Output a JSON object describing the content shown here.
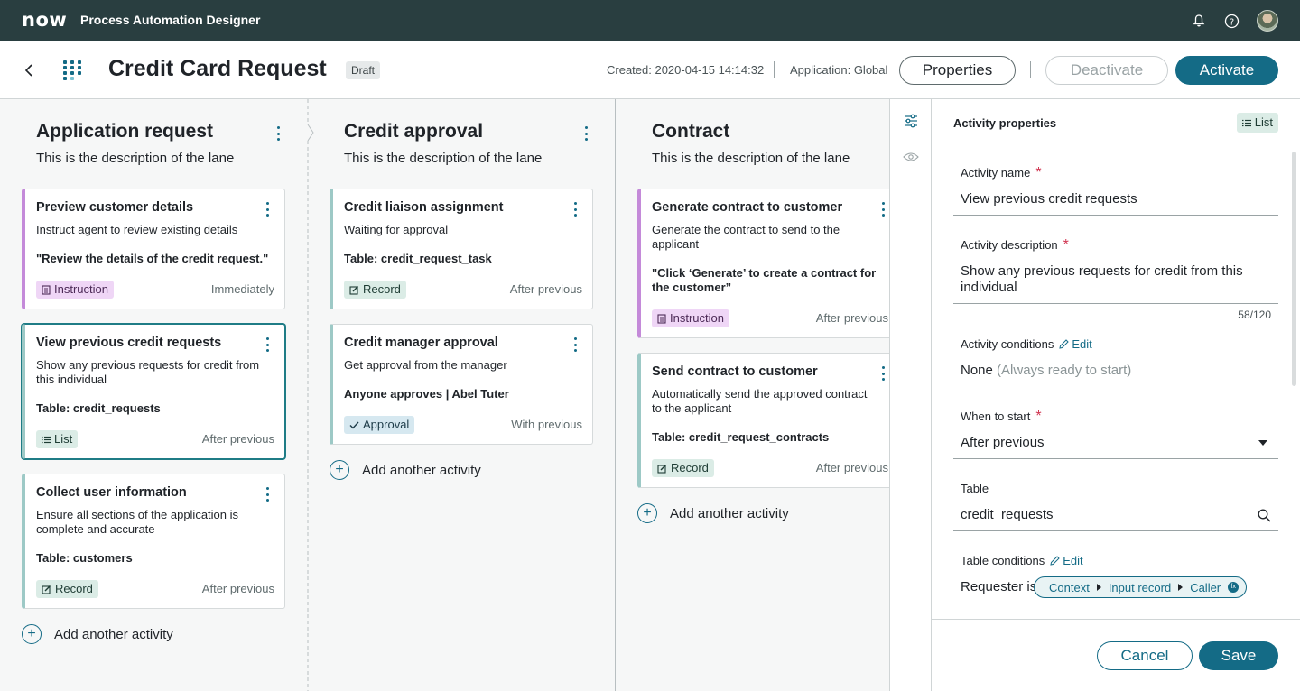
{
  "topbar": {
    "logo": "now",
    "app_title": "Process Automation Designer",
    "icons": [
      "bell-icon",
      "help-icon"
    ]
  },
  "header": {
    "title": "Credit Card Request",
    "status": "Draft",
    "created": "Created: 2020-04-15 14:14:32",
    "application": "Application: Global",
    "properties_label": "Properties",
    "deactivate_label": "Deactivate",
    "activate_label": "Activate"
  },
  "lanes": [
    {
      "title": "Application request",
      "description": "This is the description of the lane",
      "add_label": "Add another activity",
      "cards": [
        {
          "title": "Preview customer details",
          "desc1": "Instruct agent to review existing details",
          "strong1": "\"Review the details of the credit request.\"",
          "tag": "Instruction",
          "when": "Immediately"
        },
        {
          "title": "View previous credit requests",
          "desc1": "Show any previous requests for credit from",
          "desc2": "this individual",
          "strong1": "Table: credit_requests",
          "tag": "List",
          "when": "After previous"
        },
        {
          "title": "Collect user information",
          "desc1": "Ensure all sections of the application is",
          "desc2": "complete and accurate",
          "strong1": "Table: customers",
          "tag": "Record",
          "when": "After previous"
        }
      ]
    },
    {
      "title": "Credit approval",
      "description": "This is the description of the lane",
      "add_label": "Add another activity",
      "cards": [
        {
          "title": "Credit liaison assignment",
          "desc1": "Waiting for approval",
          "strong1": "Table: credit_request_task",
          "tag": "Record",
          "when": "After previous"
        },
        {
          "title": "Credit manager approval",
          "desc1": "Get approval from the manager",
          "strong1": "Anyone approves | Abel Tuter",
          "tag": "Approval",
          "when": "With previous"
        }
      ]
    },
    {
      "title": "Contract",
      "description": "This is the description of the lane",
      "add_label": "Add another activity",
      "cards": [
        {
          "title": "Generate contract to customer",
          "desc1": "Generate the contract to send to the",
          "desc2": "applicant",
          "strong1": "\"Click ‘Generate’ to create a contract for",
          "strong2": "the customer”",
          "tag": "Instruction",
          "when": "After previous"
        },
        {
          "title": "Send contract to customer",
          "desc1": "Automatically send the approved contract",
          "desc2": "to the applicant",
          "strong1": "Table: credit_request_contracts",
          "tag": "Record",
          "when": "After previous"
        }
      ]
    }
  ],
  "side_rail": {
    "icons": [
      "filter-settings-icon",
      "eye-icon"
    ]
  },
  "properties": {
    "title": "Activity properties",
    "tag": "List",
    "name_label": "Activity name",
    "name_value": "View previous credit requests",
    "desc_label": "Activity description",
    "desc_value1": "Show any previous requests for credit from this",
    "desc_value2": "individual",
    "counter": "58/120",
    "cond_label": "Activity conditions",
    "edit_label": "Edit",
    "cond_value": "None",
    "cond_hint": "(Always ready to start)",
    "when_label": "When to start",
    "when_value": "After previous",
    "table_label": "Table",
    "table_value": "credit_requests",
    "table_cond_label": "Table conditions",
    "requester": "Requester is",
    "pill": [
      "Context",
      "Input record",
      "Caller"
    ],
    "cancel_label": "Cancel",
    "save_label": "Save"
  }
}
